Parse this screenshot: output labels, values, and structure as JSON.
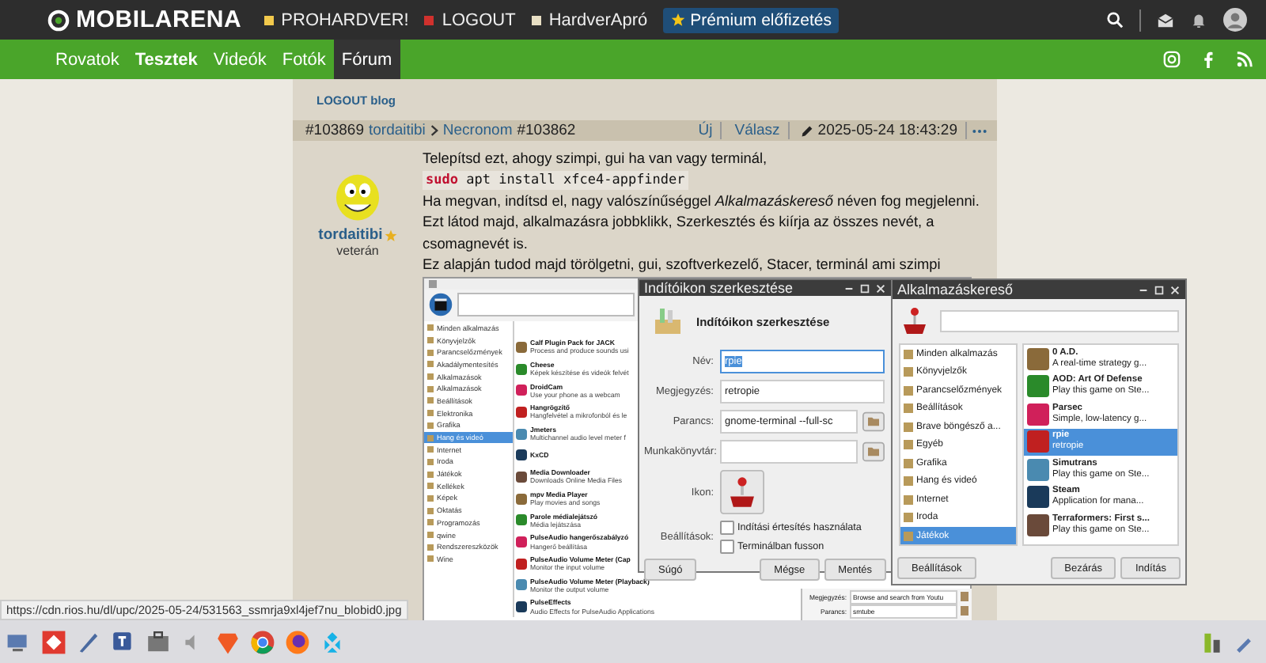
{
  "top_bar": {
    "logo": "MOBILARENA",
    "links": [
      {
        "label": "PROHARDVER!",
        "color": "#f2c94c"
      },
      {
        "label": "LOGOUT",
        "color": "#d0312d"
      },
      {
        "label": "HardverApró",
        "color": "#e8dfc4"
      }
    ],
    "premium_button": "Prémium előfizetés"
  },
  "nav": {
    "items": [
      {
        "label": "Rovatok",
        "selected": false,
        "bold": false
      },
      {
        "label": "Tesztek",
        "selected": false,
        "bold": true
      },
      {
        "label": "Videók",
        "selected": false,
        "bold": false
      },
      {
        "label": "Fotók",
        "selected": false,
        "bold": false
      },
      {
        "label": "Fórum",
        "selected": true,
        "bold": false
      }
    ]
  },
  "blog_link": "LOGOUT blog",
  "post": {
    "number": "#103869",
    "author": "tordaitibi",
    "reply_to": "Necronom",
    "reply_number": "#103862",
    "actions": [
      "Új",
      "Válasz"
    ],
    "date": "2025-05-24 18:43:29",
    "user": {
      "name": "tordaitibi",
      "rank": "veterán"
    },
    "body": [
      {
        "kind": "text",
        "text": "Telepítsd ezt, ahogy szimpi, gui ha van vagy terminál,"
      },
      {
        "kind": "code",
        "keyword": "sudo",
        "text": "apt install xfce4-appfinder"
      },
      {
        "kind": "text",
        "text": "Ha megvan, indítsd el, nagy valószínűséggel *Alkalmazáskereső* néven fog megjelenni."
      },
      {
        "kind": "text",
        "text": "Ezt látod majd, alkalmazásra jobbklikk, Szerkesztés és kiírja az összes nevét, a csomagnevét is."
      },
      {
        "kind": "text",
        "text": "Ez alapján tudod majd törölgetni, gui, szoftverkezelő, Stacer, terminál ami szimpi"
      }
    ],
    "image": {
      "categories": [
        {
          "label": "Minden alkalmazás",
          "selected": false
        },
        {
          "label": "Könyvjelzők",
          "selected": false
        },
        {
          "label": "Parancselőzmények",
          "selected": false
        },
        {
          "label": "Akadálymentesítés",
          "selected": false
        },
        {
          "label": "Alkalmazások",
          "selected": false
        },
        {
          "label": "Alkalmazások",
          "selected": false
        },
        {
          "label": "Beállítások",
          "selected": false
        },
        {
          "label": "Elektronika",
          "selected": false
        },
        {
          "label": "Grafika",
          "selected": false
        },
        {
          "label": "Hang és videó",
          "selected": true
        },
        {
          "label": "Internet",
          "selected": false
        },
        {
          "label": "Iroda",
          "selected": false
        },
        {
          "label": "Játékok",
          "selected": false
        },
        {
          "label": "Kellékek",
          "selected": false
        },
        {
          "label": "Képek",
          "selected": false
        },
        {
          "label": "Oktatás",
          "selected": false
        },
        {
          "label": "Programozás",
          "selected": false
        },
        {
          "label": "qwine",
          "selected": false
        },
        {
          "label": "Rendszereszközök",
          "selected": false
        },
        {
          "label": "Wine",
          "selected": false
        }
      ],
      "apps": [
        {
          "name": "Calf Plugin Pack for JACK",
          "desc": "Process and produce sounds usi"
        },
        {
          "name": "Cheese",
          "desc": "Képek készítése és videók felvét"
        },
        {
          "name": "DroidCam",
          "desc": "Use your phone as a webcam"
        },
        {
          "name": "Hangrögzítő",
          "desc": "Hangfelvétel a mikrofonból és le"
        },
        {
          "name": "Jmeters",
          "desc": "Multichannel audio level meter f"
        },
        {
          "name": "KxCD"
        },
        {
          "name": "Media Downloader",
          "desc": "Downloads Online Media Files"
        },
        {
          "name": "mpv Media Player",
          "desc": "Play movies and songs"
        },
        {
          "name": "Parole médialejátszó",
          "desc": "Média lejátszása"
        },
        {
          "name": "PulseAudio hangerőszabályzó",
          "desc": "Hangerő beállítása"
        },
        {
          "name": "PulseAudio Volume Meter (Cap",
          "desc": "Monitor the input volume"
        },
        {
          "name": "PulseAudio Volume Meter (Playback)",
          "desc": "Monitor the output volume"
        },
        {
          "name": "PulseEffects",
          "desc": "Audio Effects for PulseAudio Applications"
        }
      ],
      "form": [
        {
          "label": "Megjegyzés:",
          "value": "Browse and search from Youtu"
        },
        {
          "label": "Parancs:",
          "value": "smtube"
        }
      ]
    }
  },
  "editor_window": {
    "title": "Indítóikon szerkesztése",
    "heading": "Indítóikon szerkesztése",
    "fields": [
      {
        "label": "Név:",
        "value": "rpie",
        "highlighted": true,
        "browse": false
      },
      {
        "label": "Megjegyzés:",
        "value": "retropie",
        "highlighted": false,
        "browse": false
      },
      {
        "label": "Parancs:",
        "value": "gnome-terminal --full-sc",
        "highlighted": false,
        "browse": true
      },
      {
        "label": "Munkakönyvtár:",
        "highlighted": false,
        "browse": true
      }
    ],
    "icon_label": "Ikon:",
    "options_label": "Beállítások:",
    "options": [
      {
        "label": "Indítási értesítés használata",
        "checked": false
      },
      {
        "label": "Terminálban fusson",
        "checked": false
      }
    ],
    "buttons": [
      "Súgó",
      "Mégse",
      "Mentés"
    ]
  },
  "finder_window": {
    "title": "Alkalmazáskereső",
    "categories": [
      {
        "label": "Minden alkalmazás",
        "selected": false
      },
      {
        "label": "Könyvjelzők",
        "selected": false
      },
      {
        "label": "Parancselőzmények",
        "selected": false
      },
      {
        "label": "Beállítások",
        "selected": false
      },
      {
        "label": "Brave böngésző a...",
        "selected": false
      },
      {
        "label": "Egyéb",
        "selected": false
      },
      {
        "label": "Grafika",
        "selected": false
      },
      {
        "label": "Hang és videó",
        "selected": false
      },
      {
        "label": "Internet",
        "selected": false
      },
      {
        "label": "Iroda",
        "selected": false
      },
      {
        "label": "Játékok",
        "selected": true
      }
    ],
    "apps": [
      {
        "name": "0 A.D.",
        "desc": "A real-time strategy g...",
        "selected": false
      },
      {
        "name": "AOD: Art Of Defense",
        "desc": "Play this game on Ste...",
        "selected": false
      },
      {
        "name": "Parsec",
        "desc": "Simple, low-latency g...",
        "selected": false
      },
      {
        "name": "rpie",
        "desc": "retropie",
        "selected": true
      },
      {
        "name": "Simutrans",
        "desc": "Play this game on Ste...",
        "selected": false
      },
      {
        "name": "Steam",
        "desc": "Application for mana...",
        "selected": false
      },
      {
        "name": "Terraformers: First s...",
        "desc": "Play this game on Ste...",
        "selected": false
      }
    ],
    "buttons": [
      "Beállítások",
      "Bezárás",
      "Indítás"
    ]
  },
  "status_url": "https://cdn.rios.hu/dl/upc/2025-05-24/531563_ssmrja9xl4jef7nu_blobid0.jpg"
}
